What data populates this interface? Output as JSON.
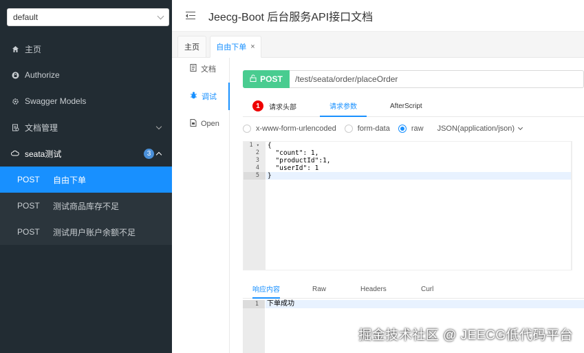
{
  "sidebar": {
    "select_value": "default",
    "menu": [
      {
        "label": "主页",
        "icon": "home-icon"
      },
      {
        "label": "Authorize",
        "icon": "lock-icon"
      },
      {
        "label": "Swagger Models",
        "icon": "settings-icon"
      },
      {
        "label": "文档管理",
        "icon": "document-icon"
      },
      {
        "label": "seata测试",
        "icon": "cloud-icon",
        "badge": "3"
      }
    ],
    "sub_items": [
      {
        "method": "POST",
        "label": "自由下单"
      },
      {
        "method": "POST",
        "label": "测试商品库存不足"
      },
      {
        "method": "POST",
        "label": "测试用户账户余额不足"
      }
    ]
  },
  "header": {
    "title": "Jeecg-Boot 后台服务API接口文档"
  },
  "tabs": [
    {
      "label": "主页"
    },
    {
      "label": "自由下单",
      "close": "×"
    }
  ],
  "vtabs": [
    {
      "label": "文档"
    },
    {
      "label": "调试"
    },
    {
      "label": "Open"
    }
  ],
  "request": {
    "method": "POST",
    "url": "/test/seata/order/placeOrder",
    "tabs": {
      "headers": "请求头部",
      "headers_badge": "1",
      "params": "请求参数",
      "afterscript": "AfterScript"
    },
    "body_types": {
      "urlencoded": "x-www-form-urlencoded",
      "formdata": "form-data",
      "raw": "raw",
      "content_type": "JSON(application/json)"
    },
    "line_numbers": [
      "1",
      "2",
      "3",
      "4",
      "5"
    ],
    "code_lines": [
      "{",
      "  \"count\": 1,",
      "  \"productId\":1,",
      "  \"userId\": 1",
      "}"
    ]
  },
  "response": {
    "tabs": {
      "content": "响应内容",
      "raw": "Raw",
      "headers": "Headers",
      "curl": "Curl"
    },
    "line_number": "1",
    "line": "下单成功"
  },
  "watermark": "掘金技术社区 @ JEECG低代码平台",
  "colors": {
    "post": "#49cc90",
    "accent": "#1890ff",
    "sidebar_bg": "#222c33"
  }
}
